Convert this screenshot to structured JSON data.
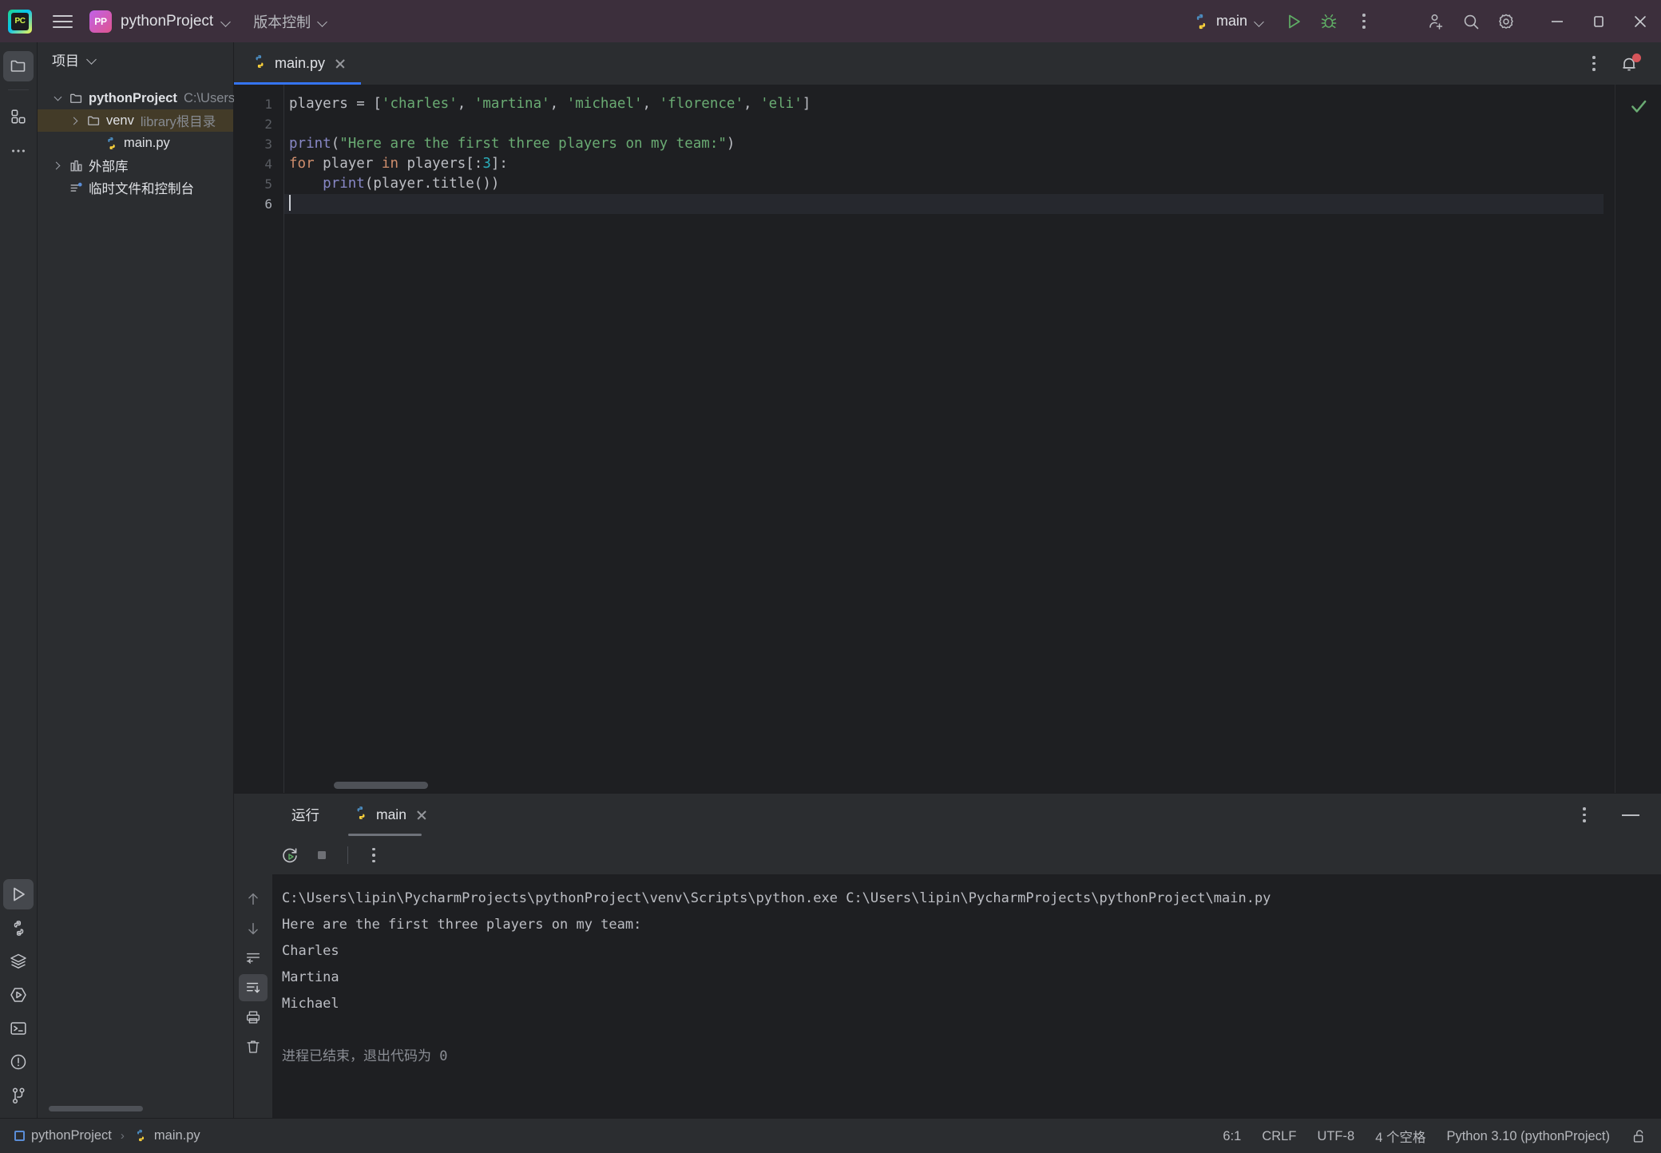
{
  "titlebar": {
    "logo_text": "PC",
    "menu_icon": "hamburger-menu-icon",
    "project_badge": "PP",
    "project_name": "pythonProject",
    "vcs_label": "版本控制",
    "run_config_name": "main",
    "icons": {
      "run": "run-icon",
      "debug": "debug-icon",
      "more": "more-vertical-icon",
      "account": "add-account-icon",
      "search": "search-icon",
      "settings": "gear-icon",
      "minimize": "minimize-icon",
      "maximize": "maximize-icon",
      "close": "close-icon"
    }
  },
  "left_strip": {
    "top": [
      {
        "name": "project-tool-button",
        "icon": "folder-icon",
        "active": true
      },
      {
        "name": "structure-tool-button",
        "icon": "grid-squares-icon",
        "active": false
      },
      {
        "name": "more-tool-windows-button",
        "icon": "ellipsis-icon",
        "active": false
      }
    ],
    "bottom": [
      {
        "name": "run-tool-button",
        "icon": "play-triangle-icon",
        "active": true
      },
      {
        "name": "python-packages-button",
        "icon": "python-icon",
        "active": false
      },
      {
        "name": "services-button",
        "icon": "layers-icon",
        "active": false
      },
      {
        "name": "python-console-button",
        "icon": "play-hexagon-icon",
        "active": false
      },
      {
        "name": "terminal-button",
        "icon": "terminal-icon",
        "active": false
      },
      {
        "name": "problems-button",
        "icon": "warning-circle-icon",
        "active": false
      },
      {
        "name": "version-control-button",
        "icon": "git-branch-icon",
        "active": false
      }
    ]
  },
  "project_pane": {
    "title": "项目",
    "tree": [
      {
        "label": "pythonProject",
        "sub": "C:\\Users\\li",
        "icon": "folder-icon",
        "arrow": "down",
        "indent": 0,
        "bold": true,
        "selected": false
      },
      {
        "label": "venv",
        "sub": "library根目录",
        "icon": "folder-icon",
        "arrow": "right",
        "indent": 1,
        "bold": false,
        "selected": true
      },
      {
        "label": "main.py",
        "sub": "",
        "icon": "python-file-icon",
        "arrow": "none",
        "indent": 2,
        "bold": false,
        "selected": false
      },
      {
        "label": "外部库",
        "sub": "",
        "icon": "library-icon",
        "arrow": "right",
        "indent": 0,
        "bold": false,
        "selected": false
      },
      {
        "label": "临时文件和控制台",
        "sub": "",
        "icon": "scratches-icon",
        "arrow": "none",
        "indent": 1,
        "bold": false,
        "selected": false
      }
    ]
  },
  "editor": {
    "tab": {
      "name": "main.py",
      "icon": "python-file-icon",
      "close": "close-icon"
    },
    "options_icon": "more-vertical-icon",
    "notification_icon": "bell-icon",
    "inspection_status_icon": "checkmark-icon",
    "line_numbers": [
      "1",
      "2",
      "3",
      "4",
      "5",
      "6"
    ],
    "current_line": 6,
    "code_lines": [
      [
        {
          "t": "players ",
          "c": "def"
        },
        {
          "t": "= [",
          "c": "def"
        },
        {
          "t": "'charles'",
          "c": "str"
        },
        {
          "t": ", ",
          "c": "def"
        },
        {
          "t": "'martina'",
          "c": "str"
        },
        {
          "t": ", ",
          "c": "def"
        },
        {
          "t": "'michael'",
          "c": "str"
        },
        {
          "t": ", ",
          "c": "def"
        },
        {
          "t": "'florence'",
          "c": "str"
        },
        {
          "t": ", ",
          "c": "def"
        },
        {
          "t": "'eli'",
          "c": "str"
        },
        {
          "t": "]",
          "c": "def"
        }
      ],
      [],
      [
        {
          "t": "print",
          "c": "fn"
        },
        {
          "t": "(",
          "c": "def"
        },
        {
          "t": "\"Here are the first three players on my team:\"",
          "c": "str"
        },
        {
          "t": ")",
          "c": "def"
        }
      ],
      [
        {
          "t": "for",
          "c": "kw"
        },
        {
          "t": " player ",
          "c": "def"
        },
        {
          "t": "in",
          "c": "kw"
        },
        {
          "t": " players[:",
          "c": "def"
        },
        {
          "t": "3",
          "c": "num"
        },
        {
          "t": "]:",
          "c": "def"
        }
      ],
      [
        {
          "t": "    ",
          "c": "def"
        },
        {
          "t": "print",
          "c": "fn"
        },
        {
          "t": "(player.title())",
          "c": "def"
        }
      ],
      []
    ]
  },
  "run_window": {
    "title": "运行",
    "tab_name": "main",
    "tab_icon": "python-file-icon",
    "tab_close": "close-icon",
    "toolbar": [
      {
        "name": "rerun-button",
        "icon": "rerun-icon"
      },
      {
        "name": "stop-button",
        "icon": "stop-square-icon"
      },
      {
        "name": "run-options-button",
        "icon": "more-vertical-icon"
      }
    ],
    "header_right": [
      {
        "name": "run-window-options-button",
        "icon": "more-vertical-icon"
      },
      {
        "name": "hide-window-button",
        "icon": "minimize-icon"
      }
    ],
    "console_side": [
      {
        "name": "scroll-up-button",
        "icon": "arrow-up-icon",
        "active": false
      },
      {
        "name": "scroll-down-button",
        "icon": "arrow-down-icon",
        "active": false
      },
      {
        "name": "soft-wrap-button",
        "icon": "soft-wrap-icon",
        "active": false
      },
      {
        "name": "scroll-to-end-button",
        "icon": "scroll-to-end-icon",
        "active": true
      },
      {
        "name": "print-button",
        "icon": "printer-icon",
        "active": false
      },
      {
        "name": "clear-all-button",
        "icon": "trash-icon",
        "active": false
      }
    ],
    "output": [
      {
        "text": "C:\\Users\\lipin\\PycharmProjects\\pythonProject\\venv\\Scripts\\python.exe C:\\Users\\lipin\\PycharmProjects\\pythonProject\\main.py",
        "dim": false
      },
      {
        "text": "Here are the first three players on my team:",
        "dim": false
      },
      {
        "text": "Charles",
        "dim": false
      },
      {
        "text": "Martina",
        "dim": false
      },
      {
        "text": "Michael",
        "dim": false
      },
      {
        "text": "",
        "dim": false
      },
      {
        "text": "进程已结束，退出代码为 0",
        "dim": true
      }
    ]
  },
  "status_bar": {
    "breadcrumb_project": "pythonProject",
    "breadcrumb_sep": "›",
    "breadcrumb_file": "main.py",
    "caret_position": "6:1",
    "line_separator": "CRLF",
    "encoding": "UTF-8",
    "indent": "4 个空格",
    "interpreter": "Python 3.10 (pythonProject)",
    "lock_icon": "unlocked-padlock-icon"
  }
}
